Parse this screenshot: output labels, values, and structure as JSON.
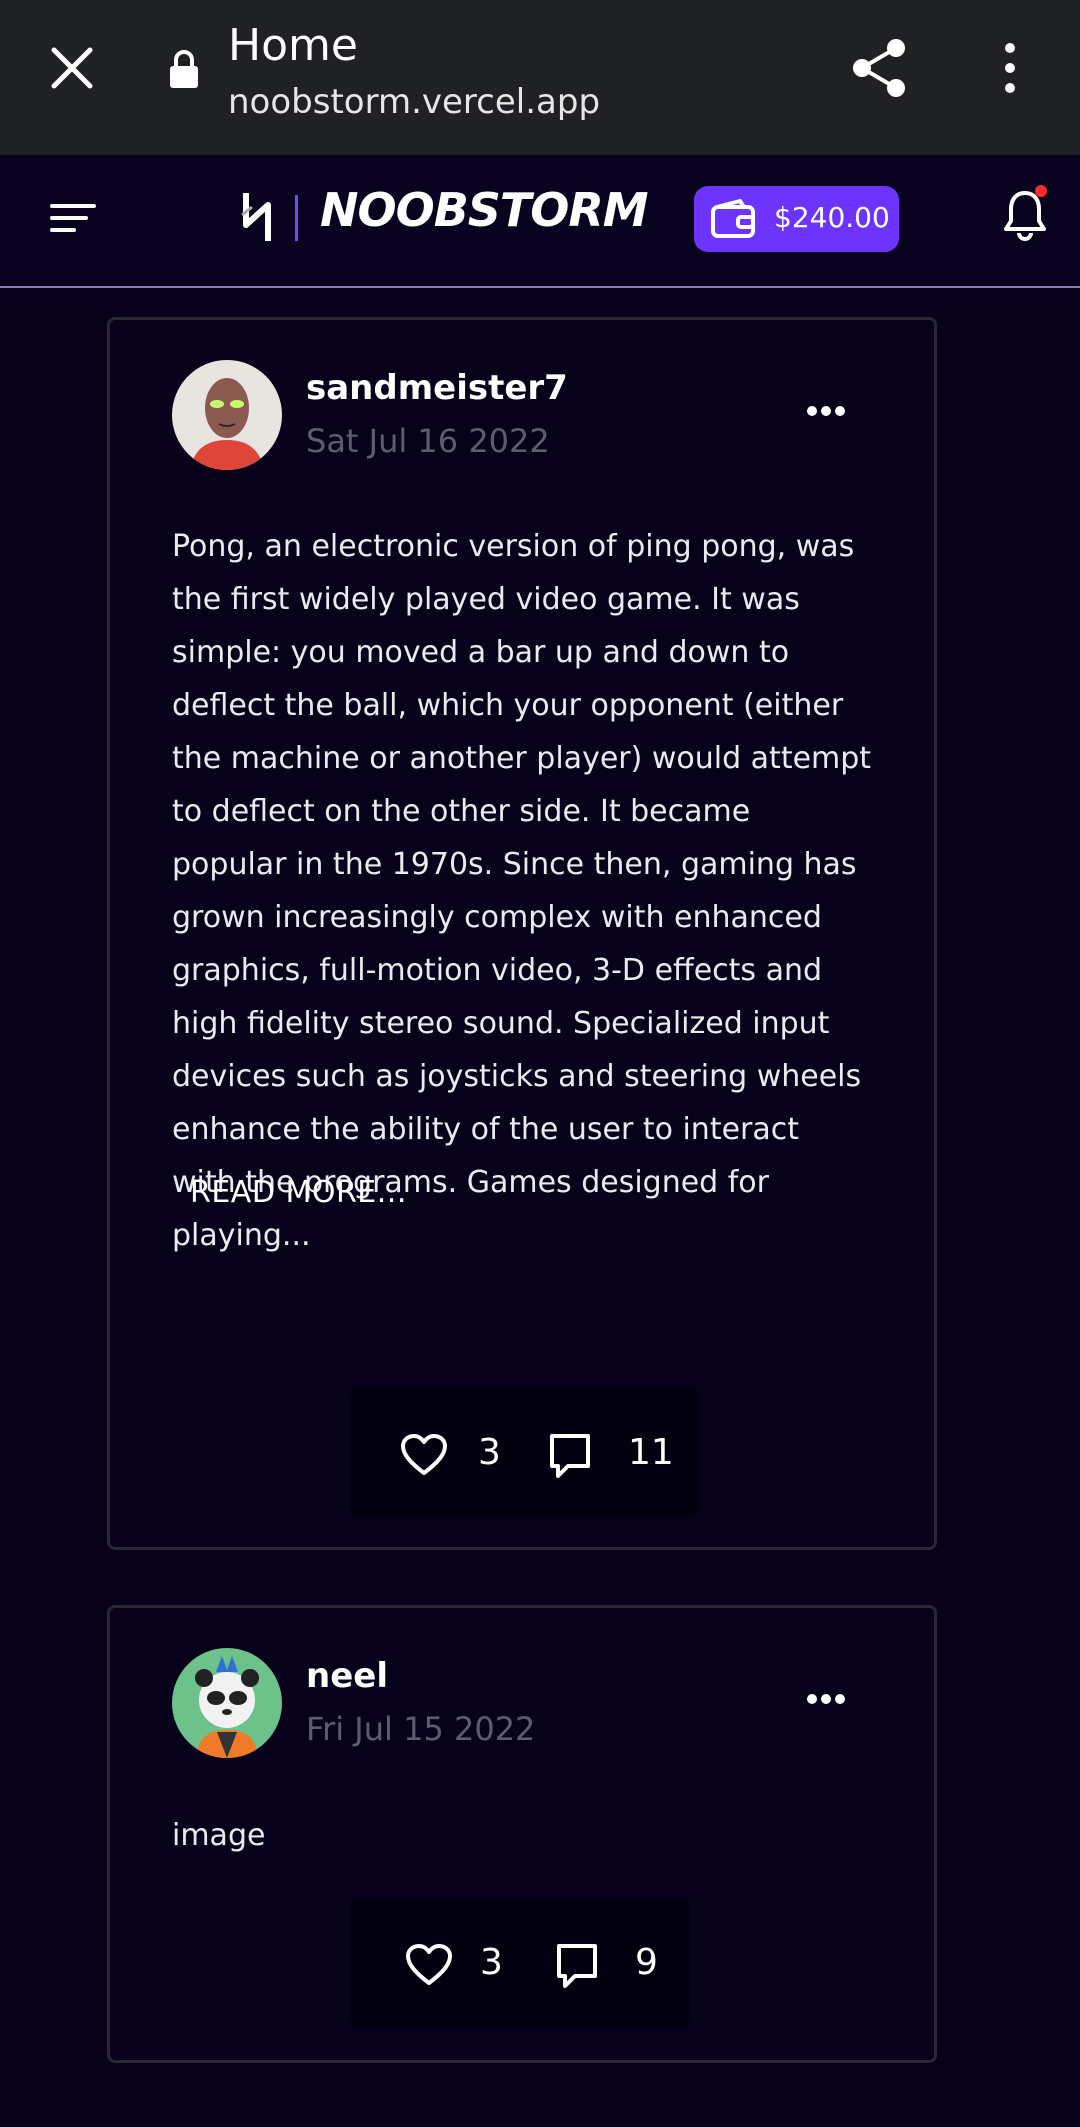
{
  "browser": {
    "title": "Home",
    "url": "noobstorm.vercel.app"
  },
  "header": {
    "logo_text": "NOOBSTORM",
    "wallet_amount": "$240.00",
    "accent_color": "#6e34ff",
    "notification_dot_color": "#ff2a2a"
  },
  "posts": [
    {
      "author": "sandmeister7",
      "date": "Sat Jul 16 2022",
      "text": "Pong, an electronic version of ping pong, was the first widely played video game. It was simple: you moved a bar up and down to deflect the ball, which your opponent (either the machine or another player) would attempt to deflect on the other side. It became popular in the 1970s. Since then, gaming has grown increasingly complex with enhanced graphics, full-motion video, 3-D effects and high fidelity stereo sound. Specialized input devices such as joysticks and steering wheels enhance the ability of the user to interact with the programs. Games designed for playing...",
      "read_more": "READ MORE...",
      "likes": "3",
      "comments": "11"
    },
    {
      "author": "neel",
      "date": "Fri Jul 15 2022",
      "text": "image",
      "likes": "3",
      "comments": "9"
    }
  ]
}
